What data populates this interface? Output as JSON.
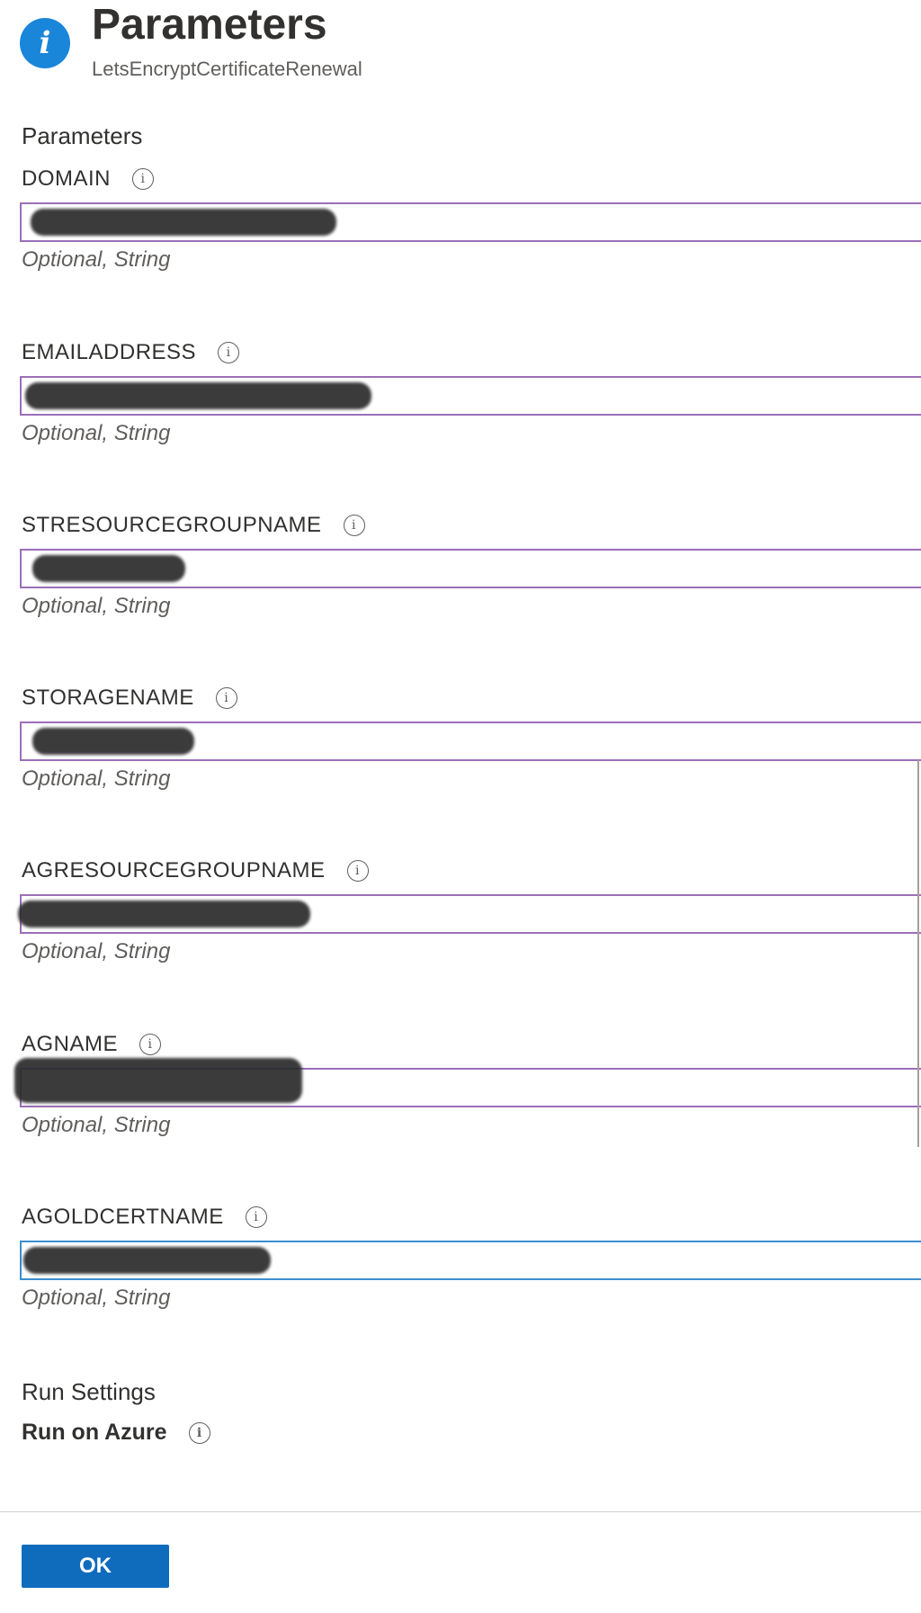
{
  "header": {
    "title": "Parameters",
    "subtitle": "LetsEncryptCertificateRenewal"
  },
  "parameters_section": {
    "heading": "Parameters",
    "fields": [
      {
        "label": "DOMAIN",
        "hint": "Optional, String"
      },
      {
        "label": "EMAILADDRESS",
        "hint": "Optional, String"
      },
      {
        "label": "STRESOURCEGROUPNAME",
        "hint": "Optional, String"
      },
      {
        "label": "STORAGENAME",
        "hint": "Optional, String"
      },
      {
        "label": "AGRESOURCEGROUPNAME",
        "hint": "Optional, String"
      },
      {
        "label": "AGNAME",
        "hint": "Optional, String"
      },
      {
        "label": "AGOLDCERTNAME",
        "hint": "Optional, String"
      }
    ]
  },
  "run_settings": {
    "heading": "Run Settings",
    "run_on_label": "Run on Azure"
  },
  "footer": {
    "ok_label": "OK"
  },
  "colors": {
    "accent": "#0f6cbd",
    "info_icon": "#1a86d9",
    "input_border": "#9b6fb8",
    "input_border_focused": "#3b8fcf"
  }
}
